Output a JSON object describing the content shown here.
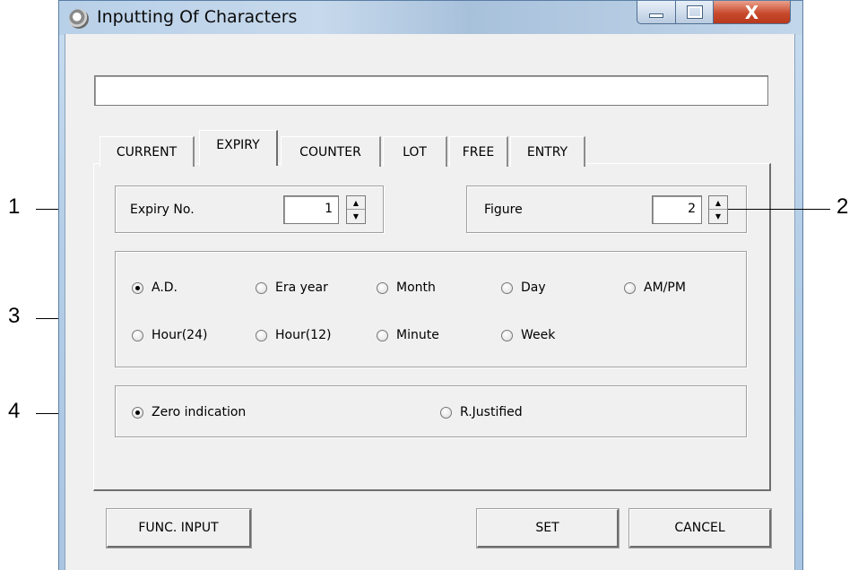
{
  "window": {
    "title": "Inputting Of Characters",
    "close_glyph": "X"
  },
  "text_field": {
    "value": ""
  },
  "tabs": [
    {
      "label": "CURRENT",
      "active": false
    },
    {
      "label": "EXPIRY",
      "active": true
    },
    {
      "label": "COUNTER",
      "active": false
    },
    {
      "label": "LOT",
      "active": false
    },
    {
      "label": "FREE",
      "active": false
    },
    {
      "label": "ENTRY",
      "active": false
    }
  ],
  "expiry_group": {
    "label": "Expiry No.",
    "value": "1"
  },
  "figure_group": {
    "label": "Figure",
    "value": "2"
  },
  "format_options": [
    {
      "label": "A.D.",
      "checked": true
    },
    {
      "label": "Era year",
      "checked": false
    },
    {
      "label": "Month",
      "checked": false
    },
    {
      "label": "Day",
      "checked": false
    },
    {
      "label": "AM/PM",
      "checked": false
    },
    {
      "label": "Hour(24)",
      "checked": false
    },
    {
      "label": "Hour(12)",
      "checked": false
    },
    {
      "label": "Minute",
      "checked": false
    },
    {
      "label": "Week",
      "checked": false
    }
  ],
  "zero_options": [
    {
      "label": "Zero indication",
      "checked": true
    },
    {
      "label": "R.Justified",
      "checked": false
    }
  ],
  "buttons": {
    "func_input": "FUNC. INPUT",
    "set": "SET",
    "cancel": "CANCEL"
  },
  "callouts": [
    "1",
    "2",
    "3",
    "4"
  ],
  "spinner": {
    "up_glyph": "▲",
    "down_glyph": "▼"
  }
}
